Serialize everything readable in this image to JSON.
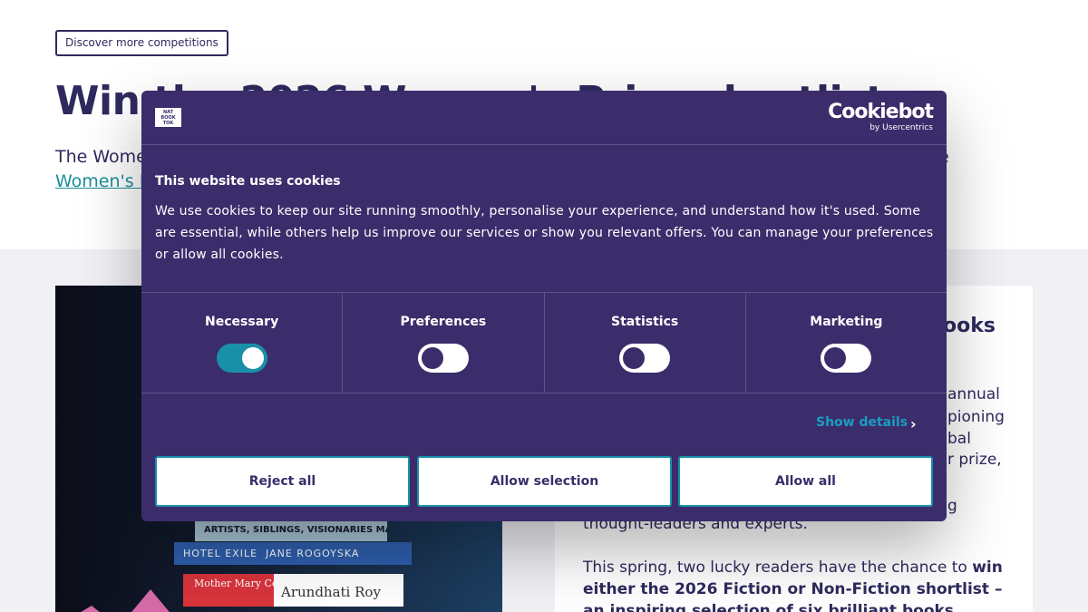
{
  "page": {
    "discover_button": "Discover more competitions",
    "title": "Win the 2026 Women's Prize shortlist",
    "intro_line1": "The Wome",
    "intro_link": "Women's P",
    "intro_tail": "e"
  },
  "card": {
    "heading_fragment": "ooks",
    "right_fragments": [
      "annual",
      "pioning",
      "bal",
      "r prize,",
      "g"
    ],
    "line_thought": "thought-leaders and experts.",
    "para2_start": "This spring, two lucky readers have the chance to ",
    "para2_bold": "win either the 2026 Fiction or Non-Fiction shortlist – an inspiring selection of six brilliant books"
  },
  "hero_books": {
    "book1": "ARTISTS, SIBLINGS, VISIONARIES",
    "book1_author": "MACKRELL",
    "book2": "HOTEL EXILE",
    "book2_author": "JANE ROGOYSKA",
    "book3_title": "Mother Mary Comes To Me",
    "book3_author": "Arundhati Roy"
  },
  "cookie_dialog": {
    "brand_logo_text": "NATIONAL BOOK TOKENS",
    "provider_name": "Cookiebot",
    "provider_sub": "by Usercentrics",
    "title": "This website uses cookies",
    "body": "We use cookies to keep our site running smoothly, personalise your experience, and understand how it's used. Some are essential, while others help us improve our services or show you relevant offers. You can manage your preferences or allow all cookies.",
    "categories": [
      {
        "label": "Necessary",
        "enabled": true
      },
      {
        "label": "Preferences",
        "enabled": false
      },
      {
        "label": "Statistics",
        "enabled": false
      },
      {
        "label": "Marketing",
        "enabled": false
      }
    ],
    "show_details": "Show details",
    "buttons": {
      "reject": "Reject all",
      "selection": "Allow selection",
      "all": "Allow all"
    }
  },
  "colors": {
    "dialog_bg": "#3b2d6b",
    "accent": "#1a8fa8",
    "text_dark": "#2e2a5e"
  },
  "icons": {
    "chevron": "chevron-right-icon"
  }
}
